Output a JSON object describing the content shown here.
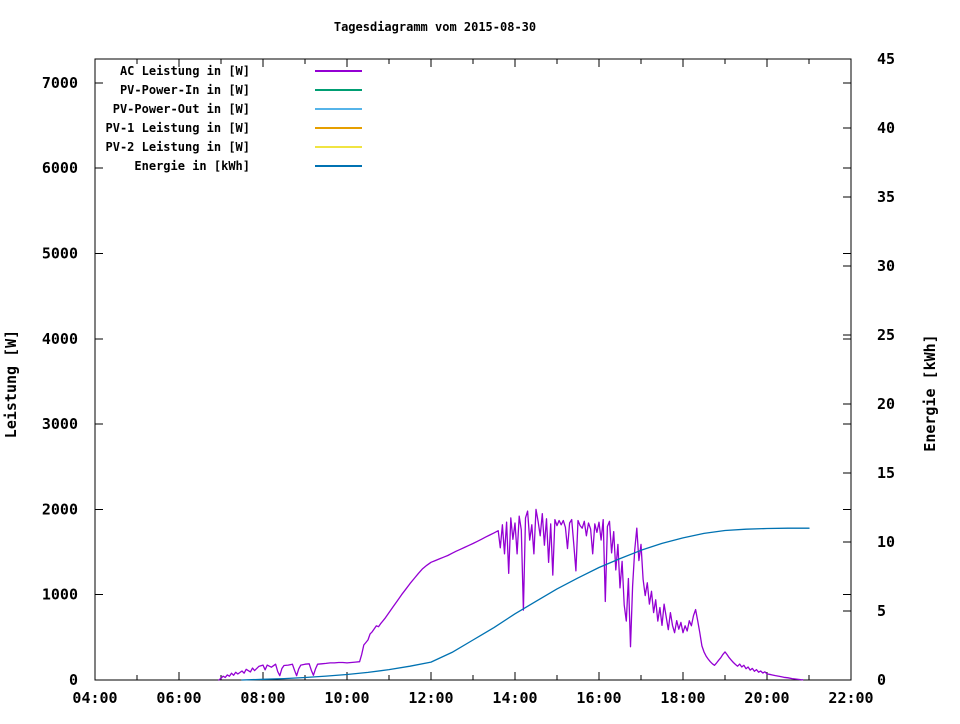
{
  "chart": {
    "title": "Tagesdiagramm vom 2015-08-30",
    "legend": [
      {
        "label": "AC Leistung in [W]",
        "color": "#9400d3",
        "series": "ac_leistung_w"
      },
      {
        "label": "PV-Power-In in [W]",
        "color": "#009e73",
        "series": "pv_power_in_w"
      },
      {
        "label": "PV-Power-Out in [W]",
        "color": "#56b4e9",
        "series": "pv_power_out_w"
      },
      {
        "label": "PV-1 Leistung in [W]",
        "color": "#e69f00",
        "series": "pv1_leistung_w"
      },
      {
        "label": "PV-2 Leistung in [W]",
        "color": "#f0e442",
        "series": "pv2_leistung_w"
      },
      {
        "label": "Energie in [kWh]",
        "color": "#0072b2",
        "series": "energie_kwh"
      }
    ],
    "axes": {
      "x": {
        "min_hour": 4,
        "max_hour": 22,
        "major": [
          {
            "hour": 4,
            "label": "04:00"
          },
          {
            "hour": 6,
            "label": "06:00"
          },
          {
            "hour": 8,
            "label": "08:00"
          },
          {
            "hour": 10,
            "label": "10:00"
          },
          {
            "hour": 12,
            "label": "12:00"
          },
          {
            "hour": 14,
            "label": "14:00"
          },
          {
            "hour": 16,
            "label": "16:00"
          },
          {
            "hour": 18,
            "label": "18:00"
          },
          {
            "hour": 20,
            "label": "20:00"
          },
          {
            "hour": 22,
            "label": "22:00"
          }
        ],
        "minor_hours": [
          5,
          7,
          9,
          11,
          13,
          15,
          17,
          19,
          21
        ]
      },
      "y_left": {
        "label": "Leistung [W]",
        "min": 0,
        "max": 7280,
        "ticks": [
          {
            "value": 0,
            "label": "0"
          },
          {
            "value": 1000,
            "label": "1000"
          },
          {
            "value": 2000,
            "label": "2000"
          },
          {
            "value": 3000,
            "label": "3000"
          },
          {
            "value": 4000,
            "label": "4000"
          },
          {
            "value": 5000,
            "label": "5000"
          },
          {
            "value": 6000,
            "label": "6000"
          },
          {
            "value": 7000,
            "label": "7000"
          }
        ]
      },
      "y_right": {
        "label": "Energie [kWh]",
        "min": 0,
        "max": 45,
        "ticks": [
          {
            "value": 0,
            "label": "0"
          },
          {
            "value": 5,
            "label": "5"
          },
          {
            "value": 10,
            "label": "10"
          },
          {
            "value": 15,
            "label": "15"
          },
          {
            "value": 20,
            "label": "20"
          },
          {
            "value": 25,
            "label": "25"
          },
          {
            "value": 30,
            "label": "30"
          },
          {
            "value": 35,
            "label": "35"
          },
          {
            "value": 40,
            "label": "40"
          },
          {
            "value": 45,
            "label": "45"
          }
        ]
      }
    }
  },
  "chart_data": {
    "type": "line",
    "title": "Tagesdiagramm vom 2015-08-30",
    "xlabel": "",
    "ylabel_left": "Leistung [W]",
    "ylabel_right": "Energie [kWh]",
    "x_range_hours": [
      4,
      22
    ],
    "y_left_range": [
      0,
      7280
    ],
    "y_right_range": [
      0,
      45
    ],
    "grid": false,
    "legend_position": "top-left-inside",
    "series": [
      {
        "name": "AC Leistung in [W]",
        "key": "ac_leistung_w",
        "axis": "left",
        "unit": "W",
        "points": [
          [
            6.95,
            0
          ],
          [
            7.0,
            20
          ],
          [
            7.05,
            45
          ],
          [
            7.1,
            30
          ],
          [
            7.15,
            60
          ],
          [
            7.2,
            45
          ],
          [
            7.25,
            80
          ],
          [
            7.3,
            55
          ],
          [
            7.35,
            90
          ],
          [
            7.4,
            70
          ],
          [
            7.5,
            105
          ],
          [
            7.55,
            80
          ],
          [
            7.6,
            125
          ],
          [
            7.7,
            95
          ],
          [
            7.75,
            140
          ],
          [
            7.8,
            110
          ],
          [
            7.9,
            160
          ],
          [
            8.0,
            175
          ],
          [
            8.05,
            120
          ],
          [
            8.1,
            175
          ],
          [
            8.2,
            150
          ],
          [
            8.3,
            185
          ],
          [
            8.35,
            100
          ],
          [
            8.4,
            50
          ],
          [
            8.45,
            135
          ],
          [
            8.5,
            170
          ],
          [
            8.6,
            175
          ],
          [
            8.7,
            185
          ],
          [
            8.75,
            115
          ],
          [
            8.8,
            50
          ],
          [
            8.85,
            130
          ],
          [
            8.9,
            175
          ],
          [
            9.0,
            185
          ],
          [
            9.1,
            190
          ],
          [
            9.15,
            115
          ],
          [
            9.2,
            55
          ],
          [
            9.25,
            130
          ],
          [
            9.3,
            185
          ],
          [
            9.4,
            190
          ],
          [
            9.5,
            195
          ],
          [
            9.6,
            200
          ],
          [
            9.7,
            200
          ],
          [
            9.8,
            205
          ],
          [
            9.9,
            205
          ],
          [
            10.0,
            200
          ],
          [
            10.1,
            205
          ],
          [
            10.2,
            210
          ],
          [
            10.3,
            215
          ],
          [
            10.35,
            300
          ],
          [
            10.4,
            410
          ],
          [
            10.45,
            440
          ],
          [
            10.5,
            470
          ],
          [
            10.55,
            540
          ],
          [
            10.6,
            565
          ],
          [
            10.65,
            600
          ],
          [
            10.7,
            635
          ],
          [
            10.75,
            625
          ],
          [
            10.8,
            660
          ],
          [
            10.9,
            720
          ],
          [
            11.0,
            790
          ],
          [
            11.1,
            860
          ],
          [
            11.2,
            930
          ],
          [
            11.3,
            1000
          ],
          [
            11.4,
            1065
          ],
          [
            11.5,
            1130
          ],
          [
            11.6,
            1190
          ],
          [
            11.7,
            1250
          ],
          [
            11.8,
            1305
          ],
          [
            11.9,
            1345
          ],
          [
            12.0,
            1380
          ],
          [
            12.1,
            1400
          ],
          [
            12.2,
            1420
          ],
          [
            12.3,
            1440
          ],
          [
            12.4,
            1460
          ],
          [
            12.5,
            1485
          ],
          [
            12.6,
            1510
          ],
          [
            12.7,
            1532
          ],
          [
            12.8,
            1555
          ],
          [
            12.9,
            1578
          ],
          [
            13.0,
            1600
          ],
          [
            13.1,
            1625
          ],
          [
            13.2,
            1650
          ],
          [
            13.3,
            1675
          ],
          [
            13.4,
            1700
          ],
          [
            13.5,
            1725
          ],
          [
            13.6,
            1750
          ],
          [
            13.65,
            1550
          ],
          [
            13.7,
            1820
          ],
          [
            13.75,
            1480
          ],
          [
            13.8,
            1850
          ],
          [
            13.85,
            1250
          ],
          [
            13.9,
            1900
          ],
          [
            13.95,
            1650
          ],
          [
            14.0,
            1840
          ],
          [
            14.05,
            1480
          ],
          [
            14.1,
            1920
          ],
          [
            14.15,
            1760
          ],
          [
            14.2,
            820
          ],
          [
            14.25,
            1900
          ],
          [
            14.3,
            1980
          ],
          [
            14.35,
            1640
          ],
          [
            14.4,
            1820
          ],
          [
            14.45,
            1480
          ],
          [
            14.5,
            2000
          ],
          [
            14.55,
            1860
          ],
          [
            14.6,
            1690
          ],
          [
            14.65,
            1950
          ],
          [
            14.7,
            1580
          ],
          [
            14.75,
            1890
          ],
          [
            14.8,
            1380
          ],
          [
            14.85,
            1830
          ],
          [
            14.9,
            1230
          ],
          [
            14.95,
            1880
          ],
          [
            15.0,
            1810
          ],
          [
            15.05,
            1870
          ],
          [
            15.1,
            1820
          ],
          [
            15.15,
            1870
          ],
          [
            15.2,
            1790
          ],
          [
            15.25,
            1540
          ],
          [
            15.3,
            1840
          ],
          [
            15.35,
            1880
          ],
          [
            15.4,
            1590
          ],
          [
            15.45,
            1280
          ],
          [
            15.5,
            1870
          ],
          [
            15.55,
            1810
          ],
          [
            15.6,
            1780
          ],
          [
            15.65,
            1860
          ],
          [
            15.7,
            1690
          ],
          [
            15.75,
            1840
          ],
          [
            15.8,
            1770
          ],
          [
            15.85,
            1480
          ],
          [
            15.9,
            1830
          ],
          [
            15.95,
            1730
          ],
          [
            16.0,
            1850
          ],
          [
            16.05,
            1640
          ],
          [
            16.1,
            1880
          ],
          [
            16.15,
            920
          ],
          [
            16.2,
            1800
          ],
          [
            16.25,
            1860
          ],
          [
            16.3,
            1490
          ],
          [
            16.35,
            1740
          ],
          [
            16.4,
            1290
          ],
          [
            16.45,
            1590
          ],
          [
            16.5,
            1080
          ],
          [
            16.55,
            1390
          ],
          [
            16.6,
            880
          ],
          [
            16.65,
            690
          ],
          [
            16.7,
            1190
          ],
          [
            16.75,
            390
          ],
          [
            16.8,
            1100
          ],
          [
            16.85,
            1520
          ],
          [
            16.9,
            1780
          ],
          [
            16.95,
            1400
          ],
          [
            17.0,
            1590
          ],
          [
            17.05,
            1180
          ],
          [
            17.1,
            990
          ],
          [
            17.15,
            1140
          ],
          [
            17.2,
            890
          ],
          [
            17.25,
            1040
          ],
          [
            17.3,
            790
          ],
          [
            17.35,
            940
          ],
          [
            17.4,
            690
          ],
          [
            17.45,
            850
          ],
          [
            17.5,
            640
          ],
          [
            17.55,
            890
          ],
          [
            17.6,
            740
          ],
          [
            17.65,
            590
          ],
          [
            17.7,
            790
          ],
          [
            17.75,
            640
          ],
          [
            17.8,
            555
          ],
          [
            17.85,
            695
          ],
          [
            17.9,
            595
          ],
          [
            17.95,
            675
          ],
          [
            18.0,
            555
          ],
          [
            18.05,
            635
          ],
          [
            18.1,
            575
          ],
          [
            18.15,
            695
          ],
          [
            18.2,
            635
          ],
          [
            18.25,
            755
          ],
          [
            18.3,
            825
          ],
          [
            18.35,
            695
          ],
          [
            18.4,
            555
          ],
          [
            18.45,
            400
          ],
          [
            18.5,
            330
          ],
          [
            18.55,
            280
          ],
          [
            18.6,
            245
          ],
          [
            18.65,
            215
          ],
          [
            18.7,
            190
          ],
          [
            18.75,
            172
          ],
          [
            18.8,
            200
          ],
          [
            18.85,
            232
          ],
          [
            18.9,
            262
          ],
          [
            18.95,
            300
          ],
          [
            19.0,
            330
          ],
          [
            19.05,
            298
          ],
          [
            19.1,
            262
          ],
          [
            19.15,
            232
          ],
          [
            19.2,
            205
          ],
          [
            19.25,
            182
          ],
          [
            19.3,
            162
          ],
          [
            19.35,
            186
          ],
          [
            19.4,
            152
          ],
          [
            19.45,
            172
          ],
          [
            19.5,
            132
          ],
          [
            19.55,
            152
          ],
          [
            19.6,
            116
          ],
          [
            19.65,
            136
          ],
          [
            19.7,
            102
          ],
          [
            19.75,
            122
          ],
          [
            19.8,
            92
          ],
          [
            19.85,
            106
          ],
          [
            19.9,
            82
          ],
          [
            19.95,
            96
          ],
          [
            20.0,
            72
          ],
          [
            20.1,
            62
          ],
          [
            20.2,
            52
          ],
          [
            20.3,
            42
          ],
          [
            20.4,
            32
          ],
          [
            20.5,
            26
          ],
          [
            20.6,
            16
          ],
          [
            20.7,
            10
          ],
          [
            20.8,
            5
          ],
          [
            20.85,
            2
          ]
        ]
      },
      {
        "name": "PV-Power-In in [W]",
        "key": "pv_power_in_w",
        "axis": "left",
        "unit": "W",
        "points": []
      },
      {
        "name": "PV-Power-Out in [W]",
        "key": "pv_power_out_w",
        "axis": "left",
        "unit": "W",
        "points": []
      },
      {
        "name": "PV-1 Leistung in [W]",
        "key": "pv1_leistung_w",
        "axis": "left",
        "unit": "W",
        "points": []
      },
      {
        "name": "PV-2 Leistung in [W]",
        "key": "pv2_leistung_w",
        "axis": "left",
        "unit": "W",
        "points": []
      },
      {
        "name": "Energie in [kWh]",
        "key": "energie_kwh",
        "axis": "right",
        "unit": "kWh",
        "points": [
          [
            7.5,
            0.0
          ],
          [
            8.0,
            0.05
          ],
          [
            8.5,
            0.1
          ],
          [
            9.0,
            0.18
          ],
          [
            9.5,
            0.28
          ],
          [
            10.0,
            0.4
          ],
          [
            10.5,
            0.55
          ],
          [
            11.0,
            0.75
          ],
          [
            11.5,
            1.0
          ],
          [
            12.0,
            1.3
          ],
          [
            12.5,
            2.0
          ],
          [
            13.0,
            2.9
          ],
          [
            13.5,
            3.8
          ],
          [
            14.0,
            4.8
          ],
          [
            14.5,
            5.7
          ],
          [
            15.0,
            6.6
          ],
          [
            15.5,
            7.4
          ],
          [
            16.0,
            8.15
          ],
          [
            16.5,
            8.8
          ],
          [
            17.0,
            9.4
          ],
          [
            17.5,
            9.9
          ],
          [
            18.0,
            10.3
          ],
          [
            18.5,
            10.62
          ],
          [
            19.0,
            10.83
          ],
          [
            19.5,
            10.93
          ],
          [
            20.0,
            10.98
          ],
          [
            20.5,
            11.0
          ],
          [
            21.0,
            11.0
          ]
        ]
      }
    ]
  }
}
